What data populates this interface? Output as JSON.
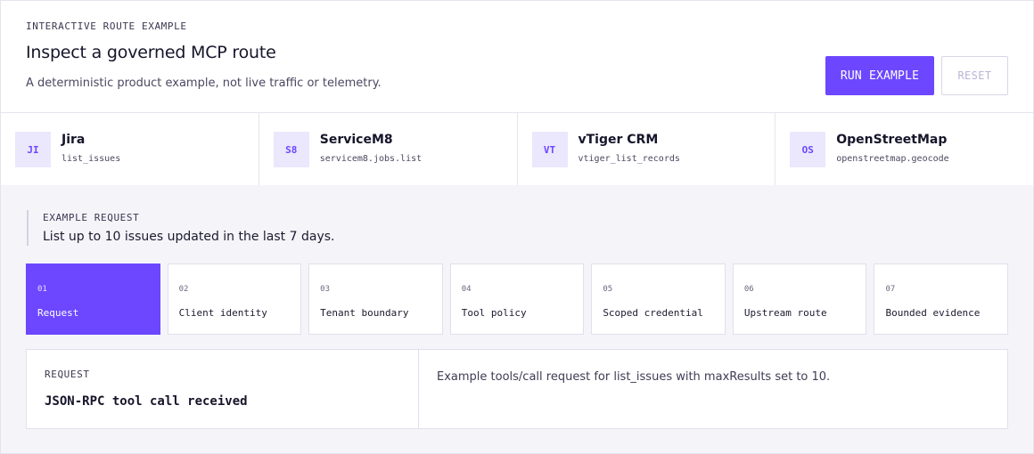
{
  "header": {
    "eyebrow": "INTERACTIVE ROUTE EXAMPLE",
    "title": "Inspect a governed MCP route",
    "subtitle": "A deterministic product example, not live traffic or telemetry.",
    "run_label": "RUN EXAMPLE",
    "reset_label": "RESET"
  },
  "services": [
    {
      "badge": "JI",
      "name": "Jira",
      "tool": "list_issues"
    },
    {
      "badge": "S8",
      "name": "ServiceM8",
      "tool": "servicem8.jobs.list"
    },
    {
      "badge": "VT",
      "name": "vTiger CRM",
      "tool": "vtiger_list_records"
    },
    {
      "badge": "OS",
      "name": "OpenStreetMap",
      "tool": "openstreetmap.geocode"
    }
  ],
  "request": {
    "label": "EXAMPLE REQUEST",
    "text": "List up to 10 issues updated in the last 7 days."
  },
  "steps": [
    {
      "num": "01",
      "label": "Request",
      "active": true
    },
    {
      "num": "02",
      "label": "Client identity",
      "active": false
    },
    {
      "num": "03",
      "label": "Tenant boundary",
      "active": false
    },
    {
      "num": "04",
      "label": "Tool policy",
      "active": false
    },
    {
      "num": "05",
      "label": "Scoped credential",
      "active": false
    },
    {
      "num": "06",
      "label": "Upstream route",
      "active": false
    },
    {
      "num": "07",
      "label": "Bounded evidence",
      "active": false
    }
  ],
  "detail": {
    "eyebrow": "REQUEST",
    "title": "JSON-RPC tool call received",
    "text": "Example tools/call request for list_issues with maxResults set to 10."
  },
  "colors": {
    "accent": "#6c47ff",
    "badge_bg": "#ebe7fd",
    "panel_bg": "#f5f4f9"
  }
}
